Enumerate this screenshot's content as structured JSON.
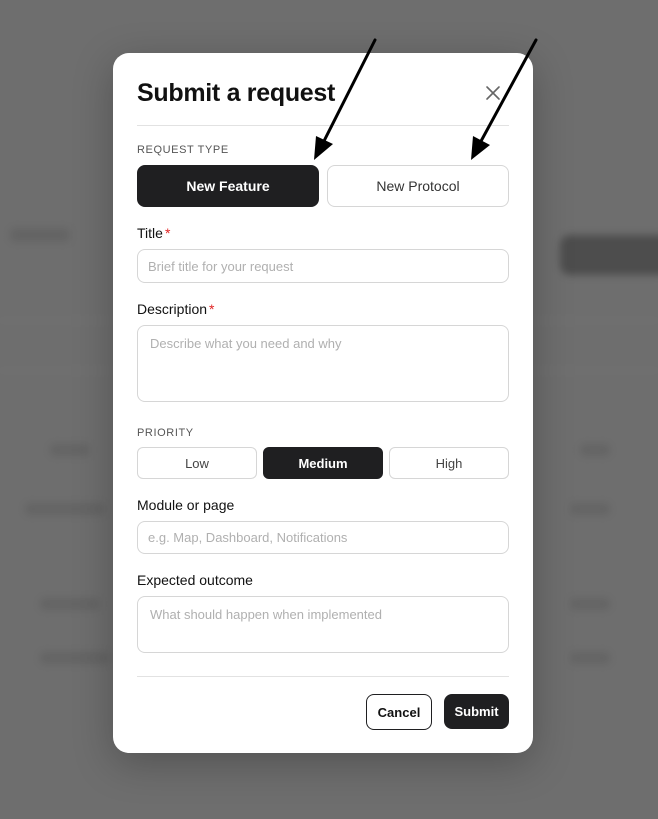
{
  "modal": {
    "title": "Submit a request",
    "close_icon": "close-icon"
  },
  "request_type": {
    "label": "REQUEST TYPE",
    "options": [
      "New Feature",
      "New Protocol"
    ],
    "selected": "New Feature"
  },
  "fields": {
    "title": {
      "label": "Title",
      "required_mark": "*",
      "placeholder": "Brief title for your request",
      "value": ""
    },
    "description": {
      "label": "Description",
      "required_mark": "*",
      "placeholder": "Describe what you need and why",
      "value": ""
    },
    "module": {
      "label": "Module or page",
      "placeholder": "e.g. Map, Dashboard, Notifications",
      "value": ""
    },
    "outcome": {
      "label": "Expected outcome",
      "placeholder": "What should happen when implemented",
      "value": ""
    }
  },
  "priority": {
    "label": "PRIORITY",
    "options": [
      "Low",
      "Medium",
      "High"
    ],
    "selected": "Medium"
  },
  "footer": {
    "cancel_label": "Cancel",
    "submit_label": "Submit"
  },
  "annotations": {
    "arrow_color": "#000000"
  },
  "colors": {
    "accent_dark": "#1f1f21",
    "required_red": "#e02424"
  }
}
